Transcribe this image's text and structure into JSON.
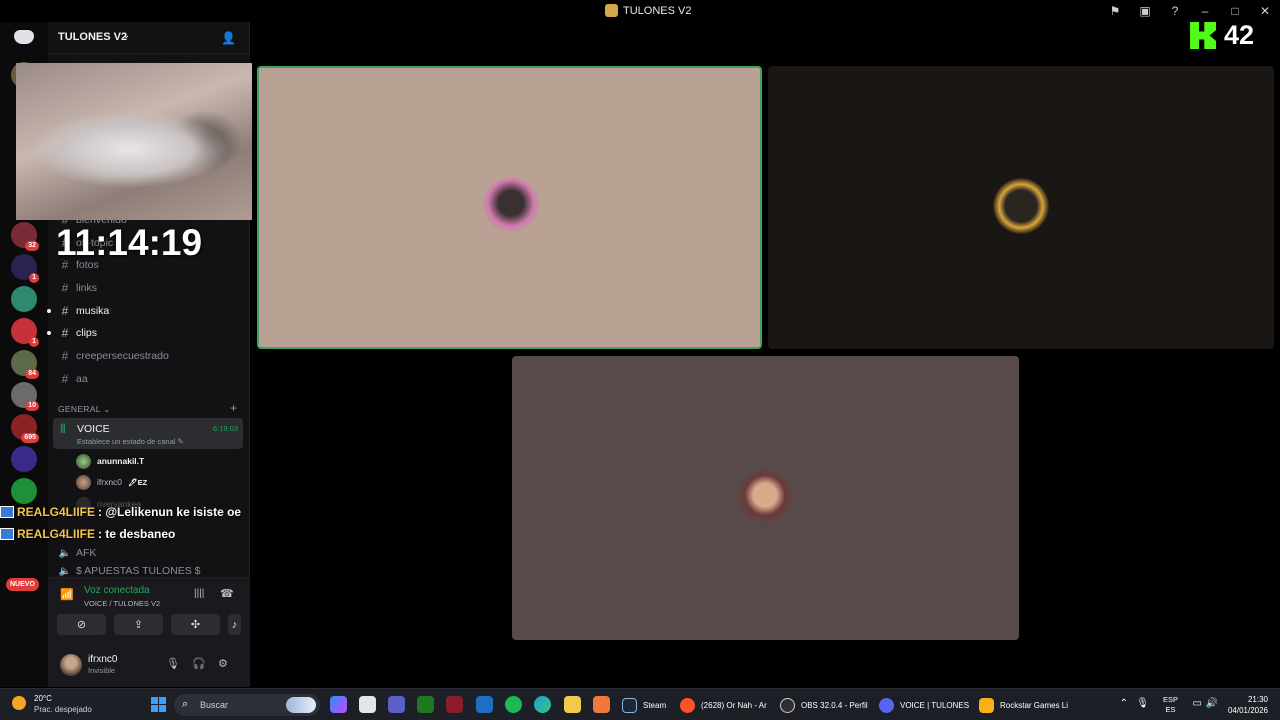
{
  "window": {
    "title": "TULONES V2",
    "controls": [
      "flag-icon",
      "inbox-icon",
      "help-icon",
      "minimize",
      "maximize",
      "close"
    ]
  },
  "guild": {
    "name": "TULONES V2"
  },
  "rail": {
    "badges": [
      "32",
      "1",
      "1",
      "84",
      "10",
      "695"
    ],
    "new_label": "NUEVO"
  },
  "channels": {
    "text": [
      {
        "name": "bienvenido",
        "bright": false
      },
      {
        "name": "off-topic",
        "bright": false
      },
      {
        "name": "fotos",
        "bright": false
      },
      {
        "name": "links",
        "bright": false
      },
      {
        "name": "musika",
        "bright": true
      },
      {
        "name": "clips",
        "bright": true
      },
      {
        "name": "creepersecuestrado",
        "bright": false
      },
      {
        "name": "aa",
        "bright": false
      }
    ],
    "category": "GENERAL",
    "voice": {
      "name": "VOICE",
      "status": "Establece un estado de canal",
      "elapsed": "6:19:03",
      "members": [
        {
          "name": "anunnakil.T",
          "tag": ""
        },
        {
          "name": "ifrxnc0",
          "tag": "EZ"
        },
        {
          "name": "riveryankee",
          "tag": ""
        }
      ]
    },
    "other_voice": [
      {
        "name": "AFK"
      },
      {
        "name": "$ APUESTAS TULONES $"
      }
    ]
  },
  "voice_panel": {
    "title": "Voz conectada",
    "subtitle": "VOICE / TULONES V2"
  },
  "user": {
    "name": "ifrxnc0",
    "status": "Invisible"
  },
  "overlay": {
    "clock": "11:14:19",
    "kick_viewers": "42",
    "chat": [
      {
        "user": "REALG4LIIFE",
        "message": ": @Lelikenun ke isiste oe"
      },
      {
        "user": "REALG4LIIFE",
        "message": ": te desbaneo"
      }
    ]
  },
  "tiles": [
    {
      "bg": "#b9a193",
      "speaking": true
    },
    {
      "bg": "#1a1613",
      "speaking": false
    },
    {
      "bg": "#594a4a",
      "speaking": false
    }
  ],
  "taskbar": {
    "weather_temp": "20°C",
    "weather_cond": "Prac. despejado",
    "search": "Buscar",
    "items": [
      {
        "label": "Steam"
      },
      {
        "label": "(2628) Or Nah - Ar"
      },
      {
        "label": "OBS 32.0.4 - Perfil"
      },
      {
        "label": "VOICE | TULONES"
      },
      {
        "label": "Rockstar Games Li"
      }
    ],
    "lang_top": "ESP",
    "lang_bottom": "ES",
    "time": "21:30",
    "date": "04/01/2026"
  },
  "colors": {
    "accent_green": "#23a55a",
    "badge_red": "#e23b3b",
    "speaking_border": "#3ba55c",
    "kick_green": "#53fc18"
  }
}
